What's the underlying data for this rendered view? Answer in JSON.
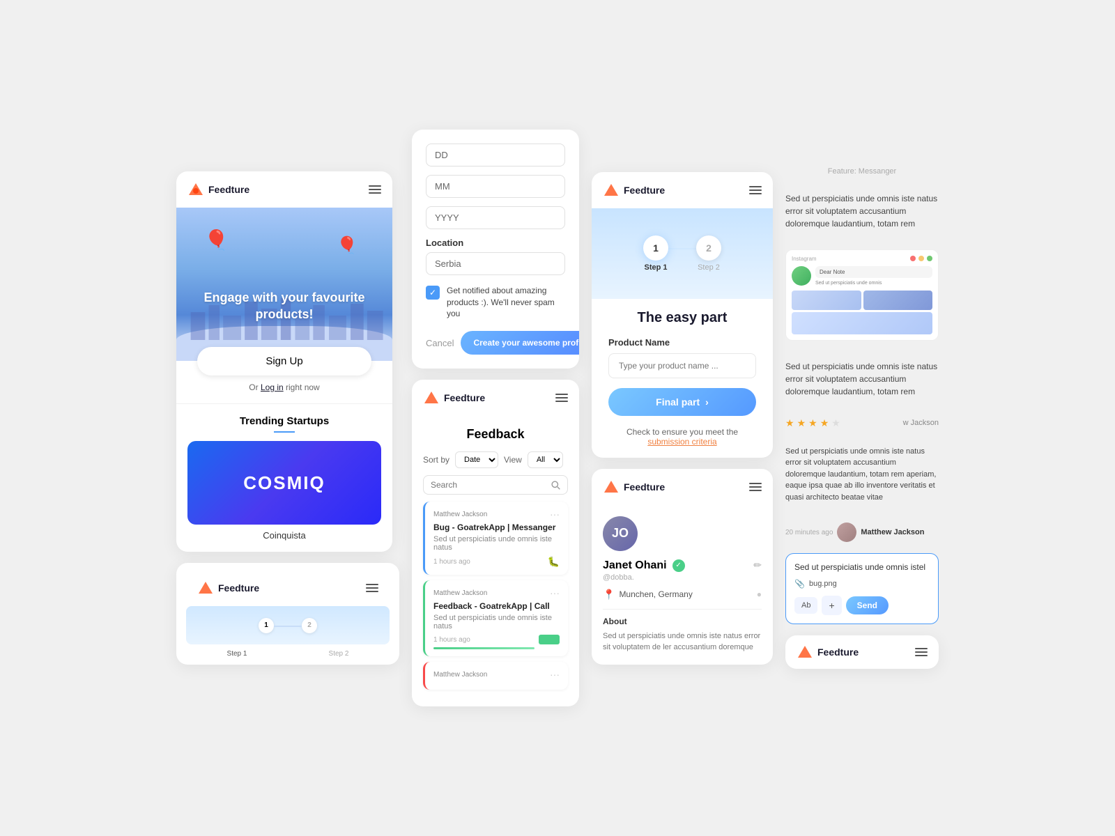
{
  "app": {
    "name": "Feedture",
    "logo_emoji": "🔶"
  },
  "col1": {
    "card_engage": {
      "title": "Feedture",
      "hero_text": "Engage with your favourite products!",
      "signup_btn": "Sign Up",
      "login_text": "Or",
      "login_link": "Log in",
      "login_suffix": " right now"
    },
    "trending": {
      "title": "Trending Startups",
      "company_name": "COSMIQ",
      "company_label": "Coinquista"
    }
  },
  "col2": {
    "profile_form": {
      "dd_label": "DD",
      "mm_label": "MM",
      "yyyy_label": "YYYY",
      "location_label": "Location",
      "location_value": "Serbia",
      "checkbox_text": "Get notified about amazing products :). We'll never spam you",
      "cancel_btn": "Cancel",
      "create_btn": "Create your awesome profile"
    }
  },
  "col3": {
    "feedback": {
      "title": "Feedback",
      "sort_by": "Sort by",
      "sort_value": "Date",
      "view_label": "View",
      "view_value": "All",
      "search_placeholder": "Search",
      "items": [
        {
          "author": "Matthew Jackson",
          "title": "Bug - GoatrekApp | Messanger",
          "desc": "Sed ut perspiciatis unde omnis iste natus",
          "time": "1 hours ago",
          "type": "bug",
          "color": "blue"
        },
        {
          "author": "Matthew Jackson",
          "title": "Feedback - GoatrekApp | Call",
          "desc": "Sed ut perspiciatis unde omnis iste natus",
          "time": "1 hours ago",
          "type": "progress",
          "color": "green"
        },
        {
          "author": "Matthew Jackson",
          "title": "",
          "desc": "",
          "time": "",
          "type": "",
          "color": "red"
        }
      ]
    }
  },
  "col4": {
    "wizard": {
      "step1_num": "1",
      "step2_num": "2",
      "step1_label": "Step 1",
      "step2_label": "Step 2",
      "heading": "The easy part",
      "product_label": "Product Name",
      "product_placeholder": "Type your product name ...",
      "final_btn": "Final part",
      "submission_text": "Check to ensure you meet the",
      "submission_link": "submission criteria"
    },
    "profile_view": {
      "title": "Feedture",
      "name": "Janet Ohani",
      "handle": "@dobba.",
      "location": "Munchen, Germany",
      "about_title": "About",
      "about_text": "Sed ut perspiciatis unde omnis iste natus error sit voluptatem de ler accusantium doremque"
    }
  },
  "col5": {
    "feature_label": "Feature: Messanger",
    "review1": {
      "text": "Sed ut perspiciatis unde omnis iste natus error sit voluptatem accusantium doloremque laudantium, totam rem"
    },
    "review2": {
      "stars": 4,
      "reviewer": "w Jackson",
      "text": "Sed ut perspiciatis unde omnis iste natus error sit voluptatem accusantium doloremque laudantium, totam rem"
    },
    "review3": {
      "text": "Sed ut perspiciatis unde omnis iste natus error sit voluptatem accusantium doloremque laudantium, totam rem aperiam, eaque ipsa quae ab illo inventore veritatis et quasi architecto beatae vitae",
      "time": "20 minutes ago",
      "reviewer": "Matthew Jackson"
    },
    "chat": {
      "input_text": "Sed ut perspiciatis unde omnis istel",
      "attachment": "bug.png",
      "ab_btn": "Ab",
      "plus_btn": "+",
      "send_btn": "Send"
    },
    "bottom_feedture": "Feedture"
  },
  "mini_step": {
    "step1": "1",
    "step2": "2",
    "label1": "Step 1",
    "label2": "Step 2"
  }
}
